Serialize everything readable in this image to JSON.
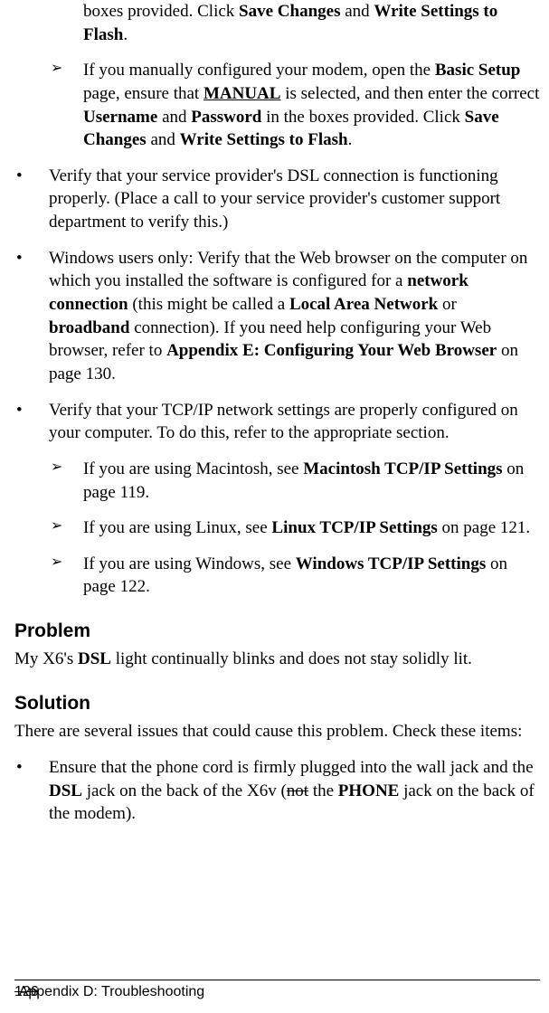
{
  "items": {
    "orphan1_pre": "boxes provided. Click ",
    "orphan1_b1": "Save Changes",
    "orphan1_mid": " and ",
    "orphan1_b2": "Write Settings to Flash",
    "orphan1_post": ".",
    "sub_manual_pre": "If you manually configured your modem, open the ",
    "sub_manual_b1": "Basic Setup",
    "sub_manual_t2": " page, ensure that ",
    "sub_manual_b2": "MANUAL",
    "sub_manual_t3": " is selected, and then enter the correct ",
    "sub_manual_b3": "Username",
    "sub_manual_t4": " and ",
    "sub_manual_b4": "Password",
    "sub_manual_t5": " in the boxes provided. Click ",
    "sub_manual_b5": "Save Changes",
    "sub_manual_t6": " and ",
    "sub_manual_b6": "Write Settings to Flash",
    "sub_manual_t7": ".",
    "verify_dsl": "Verify that your service provider's DSL connection is functioning properly. (Place a call to your service provider's customer support department to verify this.)",
    "windows_pre": "Windows users only: Verify that the Web browser on the computer on which you installed the software is configured for a ",
    "windows_b1": "network connection",
    "windows_t2": " (this might be called a ",
    "windows_b2": "Local Area Network",
    "windows_t3": " or ",
    "windows_b3": "broadband",
    "windows_t4": " connection). If you need help configuring your Web browser, refer to ",
    "windows_b4": "Appendix E: Configuring Your Web Browser",
    "windows_t5": " on page 130.",
    "verify_tcp": "Verify that your TCP/IP network settings are properly configured on your computer. To do this, refer to the appropriate section.",
    "mac_pre": "If you are using Macintosh, see ",
    "mac_b1": "Macintosh TCP/IP Settings",
    "mac_t2": " on page 119.",
    "linux_pre": "If you are using Linux, see ",
    "linux_b1": "Linux TCP/IP Settings",
    "linux_t2": " on page 121.",
    "win_pre": "If you are using Windows, see ",
    "win_b1": "Windows TCP/IP Settings",
    "win_t2": " on page 122."
  },
  "problem": {
    "heading": "Problem",
    "text_pre": "My ",
    "text_x6": "X6",
    "text_t2": "'s ",
    "text_b1": "DSL",
    "text_t3": " light continually blinks and does not stay solidly lit."
  },
  "solution": {
    "heading": "Solution",
    "intro": "There are several issues that could cause this problem. Check these items:",
    "item1_pre": "Ensure that the phone cord is firmly plugged into the wall jack and the ",
    "item1_b1": "DSL",
    "item1_t2": " jack on the back of the X6v (",
    "item1_s1": "not",
    "item1_t3": " the ",
    "item1_b2": "PHONE",
    "item1_t4": " jack on the back of the modem)."
  },
  "footer": {
    "page": "126",
    "text": "Appendix D: Troubleshooting"
  },
  "markers": {
    "dot": "•",
    "arrow": "➢"
  }
}
